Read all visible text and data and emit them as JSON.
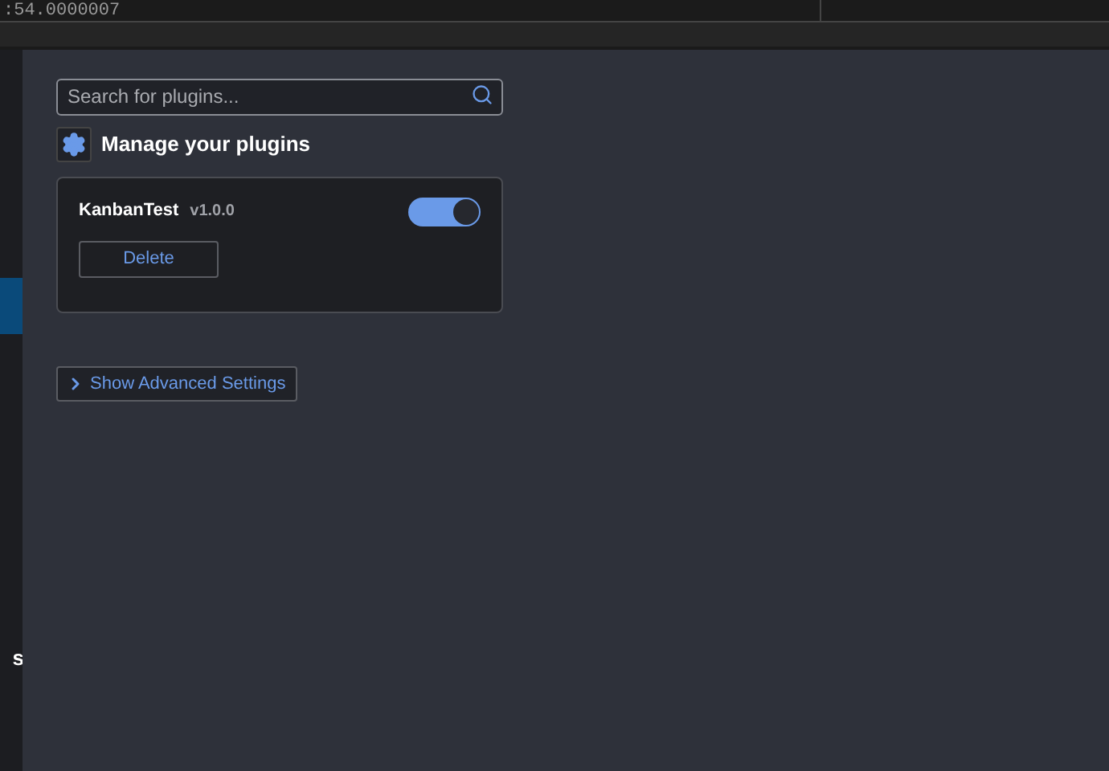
{
  "top_strip": {
    "text": ":54.0000007"
  },
  "sidebar": {
    "items": [
      {
        "selected": true
      },
      {
        "label": "s",
        "selected": false
      }
    ]
  },
  "search": {
    "placeholder": "Search for plugins..."
  },
  "section_title": "Manage your plugins",
  "plugins": [
    {
      "name": "KanbanTest",
      "version": "v1.0.0",
      "on": true,
      "delete_label": "Delete"
    }
  ],
  "advanced": {
    "label": "Show Advanced Settings",
    "expanded": false
  }
}
